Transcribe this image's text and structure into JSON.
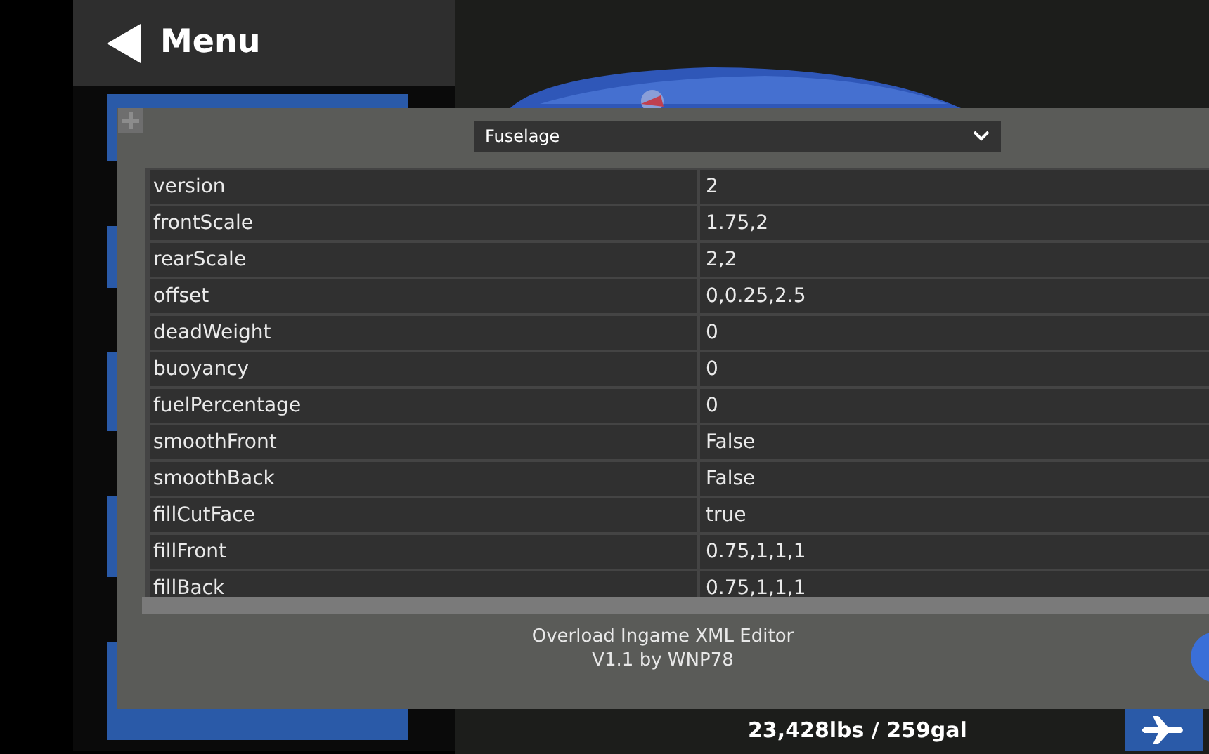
{
  "menu": {
    "title": "Menu"
  },
  "editor": {
    "part_dropdown": {
      "value": "Fuselage"
    },
    "properties": [
      {
        "name": "version",
        "value": "2"
      },
      {
        "name": "frontScale",
        "value": "1.75,2"
      },
      {
        "name": "rearScale",
        "value": "2,2"
      },
      {
        "name": "offset",
        "value": "0,0.25,2.5"
      },
      {
        "name": "deadWeight",
        "value": "0"
      },
      {
        "name": "buoyancy",
        "value": "0"
      },
      {
        "name": "fuelPercentage",
        "value": "0"
      },
      {
        "name": "smoothFront",
        "value": "False"
      },
      {
        "name": "smoothBack",
        "value": "False"
      },
      {
        "name": "fillCutFace",
        "value": "true"
      },
      {
        "name": "fillFront",
        "value": "0.75,1,1,1"
      },
      {
        "name": "fillBack",
        "value": "0.75,1,1,1"
      }
    ],
    "credits": [
      "Overload Ingame XML Editor",
      "V1.1 by WNP78"
    ]
  },
  "status": {
    "weight": "23,428lbs / 259gal"
  }
}
